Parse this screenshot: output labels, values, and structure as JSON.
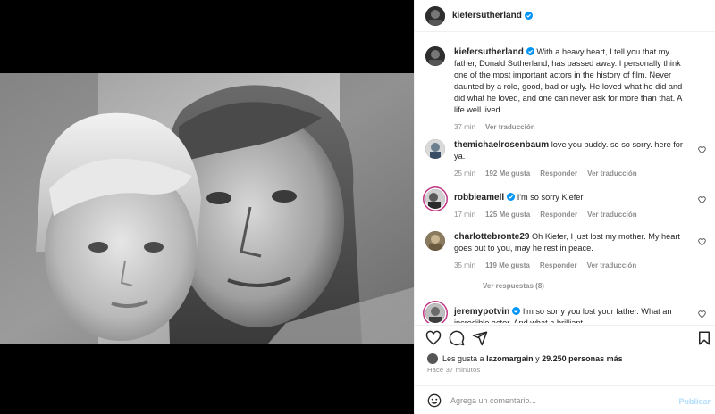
{
  "header": {
    "username": "kiefersutherland"
  },
  "caption": {
    "username": "kiefersutherland",
    "text": "With a heavy heart, I tell you that my father, Donald Sutherland, has passed away. I personally think one of the most important actors in the history of film. Never daunted by a role, good, bad or ugly. He loved what he did and did what he loved, and one can never ask for more than that. A life well lived.",
    "time": "37 min",
    "translate": "Ver traducción"
  },
  "comments": [
    {
      "username": "themichaelrosenbaum",
      "text": "love you buddy. so so sorry. here for ya.",
      "time": "25 min",
      "likes": "192 Me gusta",
      "reply": "Responder",
      "translate": "Ver traducción"
    },
    {
      "username": "robbieamell",
      "text": "I'm so sorry Kiefer",
      "time": "17 min",
      "likes": "125 Me gusta",
      "reply": "Responder",
      "translate": "Ver traducción"
    },
    {
      "username": "charlottebronte29",
      "text": "Oh Kiefer, I just lost my mother. My heart goes out to you, may he rest in peace.",
      "time": "35 min",
      "likes": "119 Me gusta",
      "reply": "Responder",
      "translate": "Ver traducción"
    },
    {
      "username": "jeremypotvin",
      "text": "I'm so sorry you lost your father. What an incredible actor. And what a brilliant"
    }
  ],
  "view_replies": "Ver respuestas (8)",
  "likes_line": {
    "prefix": "Les gusta a",
    "user": "lazomargain",
    "middle": "y",
    "count": "29.250 personas más"
  },
  "time_ago": "Hace 37 minutos",
  "add_comment": {
    "placeholder": "Agrega un comentario...",
    "publish": "Publicar"
  },
  "colors": {
    "verified": "#0095f6",
    "publish_disabled": "#b2dffc",
    "secondary_text": "#8e8e8e"
  },
  "icons": [
    "heart-icon",
    "comment-icon",
    "share-icon",
    "bookmark-icon",
    "emoji-icon",
    "verified-icon"
  ]
}
